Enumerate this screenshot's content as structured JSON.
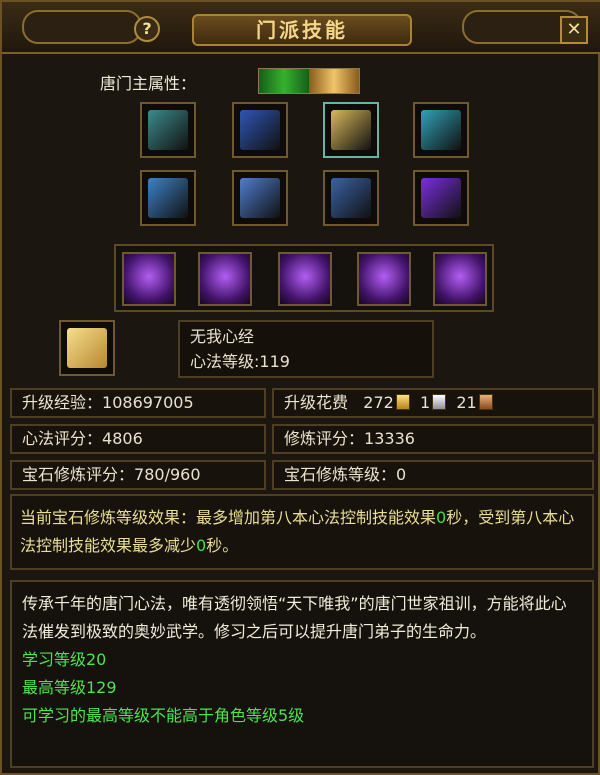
{
  "window": {
    "title": "门派技能",
    "help_label": "?",
    "close_label": "✕"
  },
  "attribute": {
    "label": "唐门主属性：",
    "colors": [
      "#36b12d",
      "#f0c46a"
    ]
  },
  "books": [
    {
      "icon": "scroll-book-icon",
      "color": "#3d8b8d"
    },
    {
      "icon": "blue-book-icon",
      "color": "#2f55b5"
    },
    {
      "icon": "gold-book-icon",
      "color": "#d8b95a"
    },
    {
      "icon": "teal-book-icon",
      "color": "#2ea3b7"
    },
    {
      "icon": "stack-book-icon",
      "color": "#3c82c9"
    },
    {
      "icon": "blue-scroll-icon",
      "color": "#4f7ccf"
    },
    {
      "icon": "dark-book-icon",
      "color": "#3b62a6"
    },
    {
      "icon": "purple-orb-icon",
      "color": "#7a2ee0"
    }
  ],
  "skills": [
    {
      "icon": "shadow-figure-icon"
    },
    {
      "icon": "dark-vortex-icon"
    },
    {
      "icon": "purple-phantom-icon"
    },
    {
      "icon": "demon-claw-icon"
    },
    {
      "icon": "lightning-figure-icon"
    }
  ],
  "selected": {
    "name": "无我心经",
    "level_label": "心法等级",
    "level_value": "119"
  },
  "stats": {
    "upgrade_exp_label": "升级经验",
    "upgrade_exp_value": "108697005",
    "upgrade_cost_label": "升级花费",
    "cost_gold": "272",
    "cost_silver": "1",
    "cost_bronze": "21",
    "mind_score_label": "心法评分",
    "mind_score_value": "4806",
    "cultivate_score_label": "修炼评分",
    "cultivate_score_value": "13336",
    "gem_score_label": "宝石修炼评分",
    "gem_score_value": "780/960",
    "gem_level_label": "宝石修炼等级",
    "gem_level_value": "0"
  },
  "effect": {
    "prefix": "当前宝石修炼等级效果：最多增加第八本心法控制技能效果",
    "value1": "0",
    "middle": "秒，受到第八本心法控制技能效果最多减少",
    "value2": "0",
    "suffix": "秒。"
  },
  "description": {
    "text": "传承千年的唐门心法，唯有透彻领悟“天下唯我”的唐门世家祖训，方能将此心法催发到极致的奥妙武学。修习之后可以提升唐门弟子的生命力。",
    "learn_level": "学习等级20",
    "max_level": "最高等级129",
    "limit": "可学习的最高等级不能高于角色等级5级"
  }
}
